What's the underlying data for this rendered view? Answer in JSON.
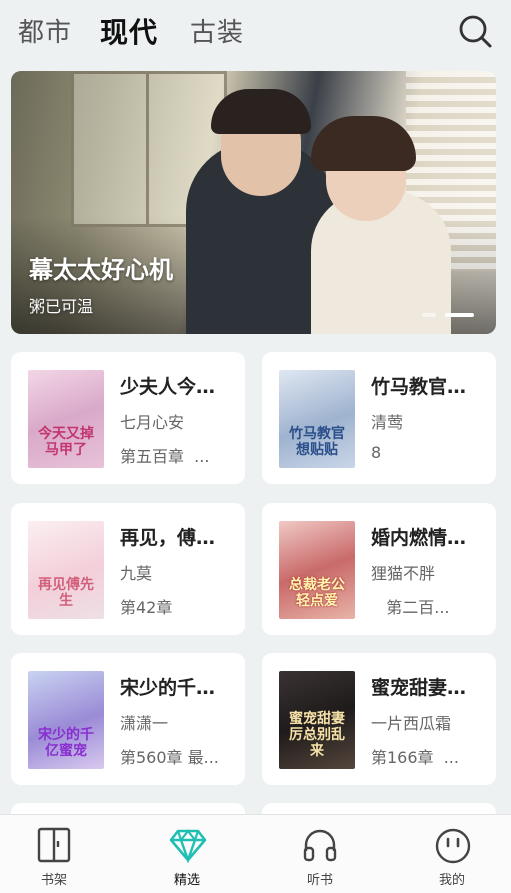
{
  "tabs": [
    {
      "label": "都市",
      "active": false
    },
    {
      "label": "现代",
      "active": true
    },
    {
      "label": "古装",
      "active": false
    }
  ],
  "search_icon": "search-icon",
  "banner": {
    "title": "幕太太好心机",
    "subtitle": "粥已可温",
    "dots": 2,
    "active_dot": 2
  },
  "books": [
    {
      "title": "少夫人今天又掉马甲了",
      "author": "七月心安",
      "chapter": "第五百章  ...",
      "cover_text": "今天又掉马甲了"
    },
    {
      "title": "竹马教官一想贴贴",
      "author": "清莺",
      "chapter": "8",
      "cover_text": "竹马教官想贴贴"
    },
    {
      "title": "再见，傅先生",
      "author": "九莫",
      "chapter": "第42章",
      "cover_text": "再见傅先生"
    },
    {
      "title": "婚内燃情：总裁老公轻点爱",
      "author": "狸猫不胖",
      "chapter": "   第二百...",
      "cover_text": "总裁老公轻点爱"
    },
    {
      "title": "宋少的千亿蜜宠",
      "author": "潇潇一",
      "chapter": "第560章 最...",
      "cover_text": "宋少的千亿蜜宠"
    },
    {
      "title": "蜜宠甜妻：厉总别乱来",
      "author": "一片西瓜霜",
      "chapter": "第166章  ...",
      "cover_text": "蜜宠甜妻厉总别乱来"
    }
  ],
  "nav": [
    {
      "label": "书架",
      "icon": "bookshelf-icon",
      "active": false
    },
    {
      "label": "精选",
      "icon": "diamond-icon",
      "active": true
    },
    {
      "label": "听书",
      "icon": "headphones-icon",
      "active": false
    },
    {
      "label": "我的",
      "icon": "smiley-icon",
      "active": false
    }
  ],
  "colors": {
    "accent": "#1fbfb3",
    "background": "#edf1f2"
  }
}
